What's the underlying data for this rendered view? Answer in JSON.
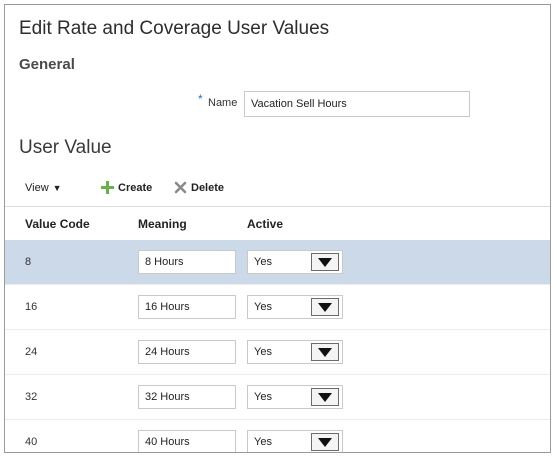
{
  "page": {
    "title": "Edit Rate and Coverage User Values"
  },
  "general": {
    "header": "General",
    "required_marker": "*",
    "name_label": "Name",
    "name_value": "Vacation Sell Hours"
  },
  "user_value": {
    "title": "User Value",
    "toolbar": {
      "view_label": "View",
      "create_label": "Create",
      "delete_label": "Delete"
    },
    "columns": [
      "Value Code",
      "Meaning",
      "Active"
    ],
    "rows": [
      {
        "code": "8",
        "meaning": "8 Hours",
        "active": "Yes"
      },
      {
        "code": "16",
        "meaning": "16 Hours",
        "active": "Yes"
      },
      {
        "code": "24",
        "meaning": "24 Hours",
        "active": "Yes"
      },
      {
        "code": "32",
        "meaning": "32 Hours",
        "active": "Yes"
      },
      {
        "code": "40",
        "meaning": "40 Hours",
        "active": "Yes"
      }
    ],
    "selected_row": 0
  },
  "colors": {
    "selected_row_bg": "#ccd9e8",
    "required_marker": "#1f74c4",
    "create_icon": "#6ab04c",
    "delete_icon": "#8a8a8a"
  },
  "icons": {
    "view_caret": "caret-down-icon",
    "create": "plus-icon",
    "delete": "x-icon",
    "select": "dropdown-arrow-icon"
  }
}
